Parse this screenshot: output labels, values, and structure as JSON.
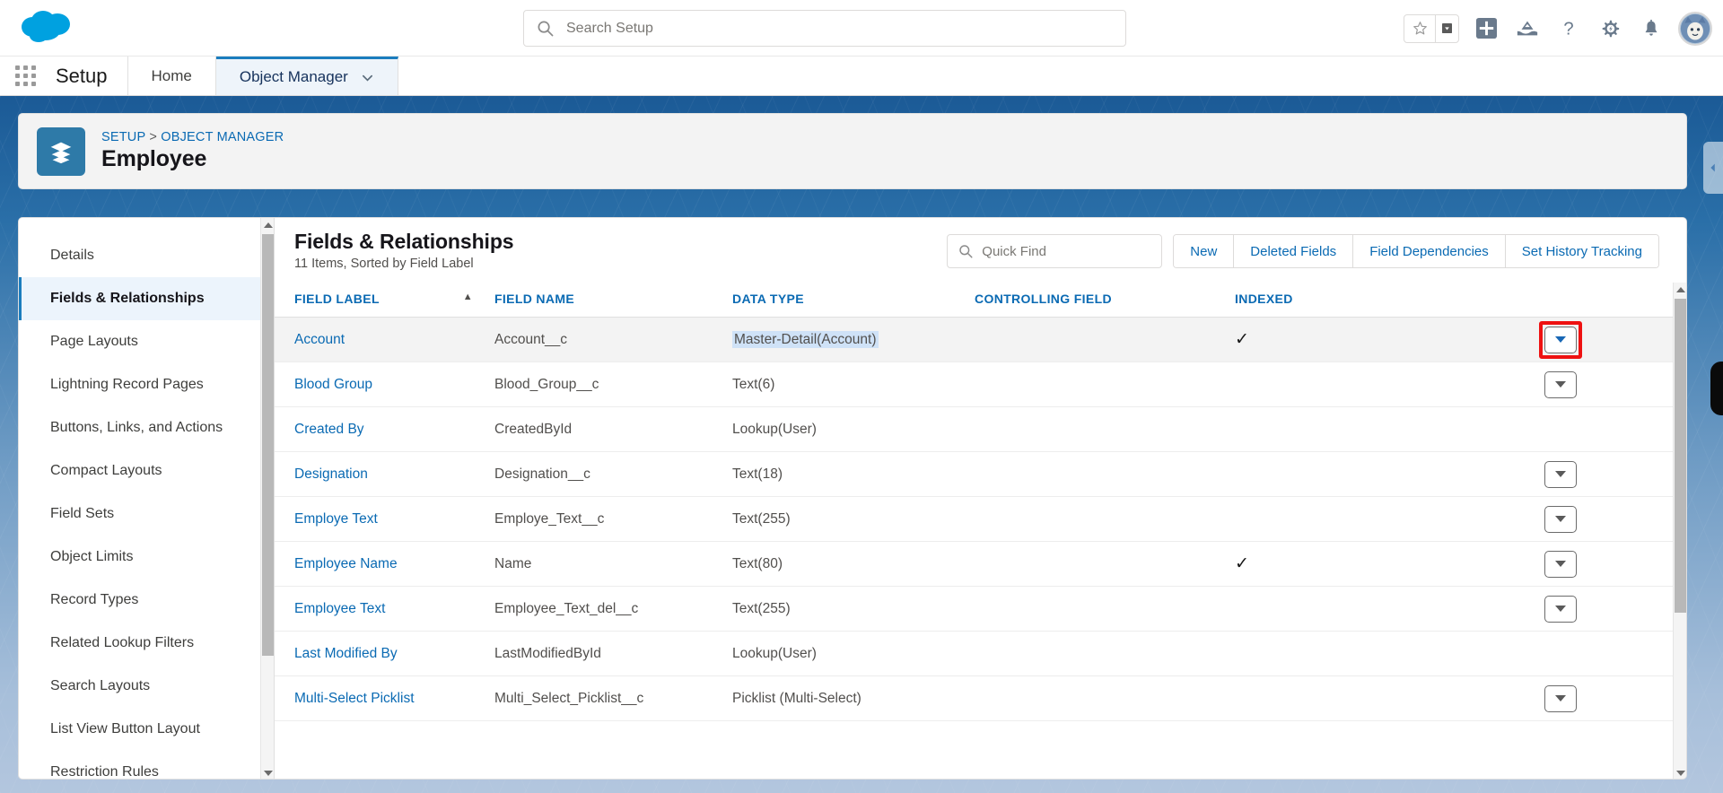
{
  "global_header": {
    "logo_name": "salesforce-cloud-logo",
    "search": {
      "placeholder": "Search Setup",
      "value": ""
    },
    "icons": [
      {
        "name": "favorites-star-icon",
        "glyph": "★"
      },
      {
        "name": "favorites-caret-icon",
        "glyph": "▼"
      },
      {
        "name": "add-icon",
        "glyph": "+"
      },
      {
        "name": "mountain-landscape-icon",
        "glyph": "⛰"
      },
      {
        "name": "help-icon",
        "glyph": "?"
      },
      {
        "name": "setup-gear-icon",
        "glyph": "⚙"
      },
      {
        "name": "notifications-bell-icon",
        "glyph": "🔔"
      },
      {
        "name": "user-avatar",
        "glyph": ""
      }
    ]
  },
  "setup_nav": {
    "app_launcher_label": "app-launcher",
    "setup_label": "Setup",
    "tabs": [
      {
        "label": "Home",
        "active": false,
        "has_caret": false
      },
      {
        "label": "Object Manager",
        "active": true,
        "has_caret": true
      }
    ],
    "caret_glyph": "⌄"
  },
  "record_header": {
    "object_icon": "stacked-layers-icon",
    "breadcrumb_setup": "SETUP",
    "breadcrumb_sep": ">",
    "breadcrumb_object_manager": "OBJECT MANAGER",
    "title": "Employee"
  },
  "sidebar": {
    "items": [
      {
        "label": "Details",
        "active": false
      },
      {
        "label": "Fields & Relationships",
        "active": true
      },
      {
        "label": "Page Layouts",
        "active": false
      },
      {
        "label": "Lightning Record Pages",
        "active": false
      },
      {
        "label": "Buttons, Links, and Actions",
        "active": false
      },
      {
        "label": "Compact Layouts",
        "active": false
      },
      {
        "label": "Field Sets",
        "active": false
      },
      {
        "label": "Object Limits",
        "active": false
      },
      {
        "label": "Record Types",
        "active": false
      },
      {
        "label": "Related Lookup Filters",
        "active": false
      },
      {
        "label": "Search Layouts",
        "active": false
      },
      {
        "label": "List View Button Layout",
        "active": false
      },
      {
        "label": "Restriction Rules",
        "active": false
      }
    ]
  },
  "content": {
    "title": "Fields & Relationships",
    "subtitle": "11 Items, Sorted by Field Label",
    "quick_find": {
      "placeholder": "Quick Find",
      "value": ""
    },
    "buttons": [
      {
        "label": "New"
      },
      {
        "label": "Deleted Fields"
      },
      {
        "label": "Field Dependencies"
      },
      {
        "label": "Set History Tracking"
      }
    ],
    "columns": [
      {
        "label": "FIELD LABEL",
        "sorted": true,
        "sort_dir": "asc"
      },
      {
        "label": "FIELD NAME",
        "sorted": false
      },
      {
        "label": "DATA TYPE",
        "sorted": false
      },
      {
        "label": "CONTROLLING FIELD",
        "sorted": false
      },
      {
        "label": "INDEXED",
        "sorted": false
      }
    ],
    "sort_asc_glyph": "▲",
    "check_glyph": "✓",
    "rows": [
      {
        "field_label": "Account",
        "field_name": "Account__c",
        "data_type": "Master-Detail(Account)",
        "controlling_field": "",
        "indexed": true,
        "highlighted": true,
        "type_highlighted": true,
        "has_menu": true,
        "menu_focused": true
      },
      {
        "field_label": "Blood Group",
        "field_name": "Blood_Group__c",
        "data_type": "Text(6)",
        "controlling_field": "",
        "indexed": false,
        "highlighted": false,
        "type_highlighted": false,
        "has_menu": true,
        "menu_focused": false
      },
      {
        "field_label": "Created By",
        "field_name": "CreatedById",
        "data_type": "Lookup(User)",
        "controlling_field": "",
        "indexed": false,
        "highlighted": false,
        "type_highlighted": false,
        "has_menu": false,
        "menu_focused": false
      },
      {
        "field_label": "Designation",
        "field_name": "Designation__c",
        "data_type": "Text(18)",
        "controlling_field": "",
        "indexed": false,
        "highlighted": false,
        "type_highlighted": false,
        "has_menu": true,
        "menu_focused": false
      },
      {
        "field_label": "Employe Text",
        "field_name": "Employe_Text__c",
        "data_type": "Text(255)",
        "controlling_field": "",
        "indexed": false,
        "highlighted": false,
        "type_highlighted": false,
        "has_menu": true,
        "menu_focused": false
      },
      {
        "field_label": "Employee Name",
        "field_name": "Name",
        "data_type": "Text(80)",
        "controlling_field": "",
        "indexed": true,
        "highlighted": false,
        "type_highlighted": false,
        "has_menu": true,
        "menu_focused": false
      },
      {
        "field_label": "Employee Text",
        "field_name": "Employee_Text_del__c",
        "data_type": "Text(255)",
        "controlling_field": "",
        "indexed": false,
        "highlighted": false,
        "type_highlighted": false,
        "has_menu": true,
        "menu_focused": false
      },
      {
        "field_label": "Last Modified By",
        "field_name": "LastModifiedById",
        "data_type": "Lookup(User)",
        "controlling_field": "",
        "indexed": false,
        "highlighted": false,
        "type_highlighted": false,
        "has_menu": false,
        "menu_focused": false
      },
      {
        "field_label": "Multi-Select Picklist",
        "field_name": "Multi_Select_Picklist__c",
        "data_type": "Picklist (Multi-Select)",
        "controlling_field": "",
        "indexed": false,
        "highlighted": false,
        "type_highlighted": false,
        "has_menu": true,
        "menu_focused": false
      }
    ]
  },
  "right_panel": {
    "collapse_handle_icon": "chevron-left-icon",
    "glyph": "◀"
  },
  "colors": {
    "brand_blue": "#0a6ab3",
    "active_tab_blue": "#1b7dbe",
    "object_icon_blue": "#2e7aa8",
    "focus_red": "#ee1111",
    "cloud_blue": "#00a1e0",
    "row_highlight": "#f3f3f3",
    "cell_highlight": "#cfe2f7"
  }
}
